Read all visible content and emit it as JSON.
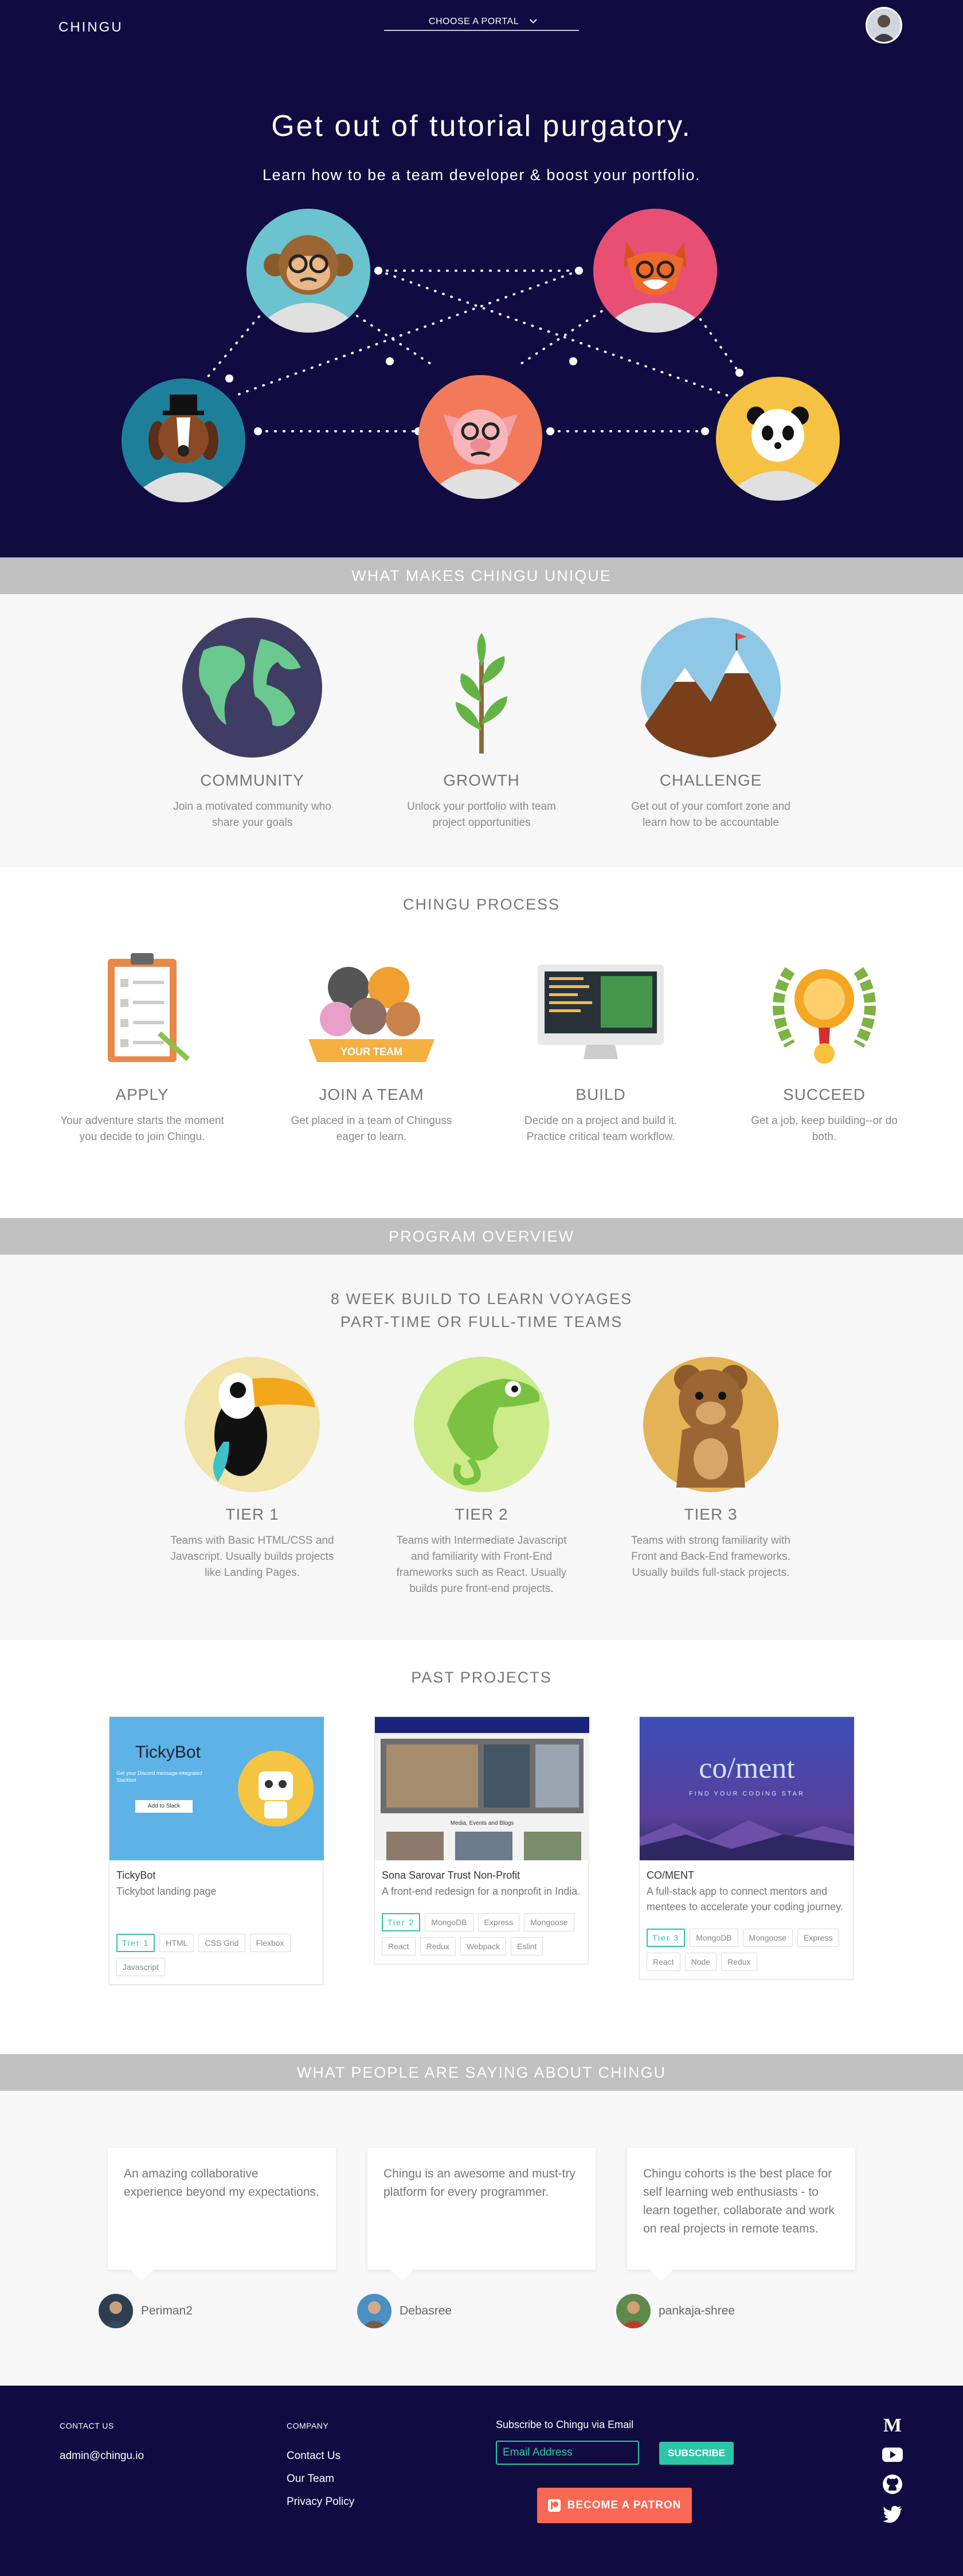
{
  "header": {
    "logo": "CHINGU",
    "portal_label": "CHOOSE A PORTAL",
    "avatar_icon": "user-avatar-icon"
  },
  "hero": {
    "title": "Get out of tutorial purgatory.",
    "subtitle": "Learn how to be a team developer & boost your portfolio.",
    "animals": [
      "monkey",
      "fox",
      "dog",
      "pig",
      "panda"
    ]
  },
  "unique": {
    "heading": "WHAT MAKES CHINGU UNIQUE",
    "items": [
      {
        "title": "COMMUNITY",
        "text": "Join a motivated community who share your goals",
        "icon": "globe-icon"
      },
      {
        "title": "GROWTH",
        "text": "Unlock your portfolio with team project opportunities",
        "icon": "sprout-icon"
      },
      {
        "title": "CHALLENGE",
        "text": "Get out of your comfort zone and learn how to be accountable",
        "icon": "mountain-icon"
      }
    ]
  },
  "process": {
    "heading": "CHINGU PROCESS",
    "items": [
      {
        "title": "APPLY",
        "text": "Your adventure starts the moment you decide to join Chingu.",
        "icon": "clipboard-icon"
      },
      {
        "title": "JOIN A TEAM",
        "text": "Get placed in a team of Chinguss eager to learn.",
        "icon": "team-icon",
        "badge": "YOUR TEAM"
      },
      {
        "title": "BUILD",
        "text": "Decide on a project and build it. Practice critical team workflow.",
        "icon": "monitor-icon"
      },
      {
        "title": "SUCCEED",
        "text": "Get a job, keep building--or do both.",
        "icon": "laurel-medal-icon"
      }
    ]
  },
  "program": {
    "heading": "PROGRAM OVERVIEW",
    "line1": "8 WEEK BUILD TO LEARN VOYAGES",
    "line2": "PART-TIME OR FULL-TIME TEAMS",
    "tiers": [
      {
        "title": "TIER 1",
        "text": "Teams with Basic HTML/CSS and Javascript. Usually builds projects like Landing Pages.",
        "icon": "toucan-icon"
      },
      {
        "title": "TIER 2",
        "text": "Teams with Intermediate Javascript and familiarity with Front-End frameworks such as React. Usually builds pure front-end projects.",
        "icon": "chameleon-icon"
      },
      {
        "title": "TIER 3",
        "text": "Teams with strong familiarity with Front and Back-End frameworks. Usually builds full-stack projects.",
        "icon": "bear-icon"
      }
    ]
  },
  "projects": {
    "heading": "PAST PROJECTS",
    "items": [
      {
        "name": "TickyBot",
        "desc": "Tickybot landing page",
        "tags": [
          "Tier 1",
          "HTML",
          "CSS Grid",
          "Flexbox",
          "Javascript"
        ],
        "shot": {
          "brand": "TickyBot",
          "tagline": "Get your Discord message-integrated Slackbot",
          "button": "Add to Slack"
        }
      },
      {
        "name": "Sona Sarovar Trust Non-Profit",
        "desc": "A front-end redesign for a nonprofit in India.",
        "tags": [
          "Tier 2",
          "MongoDB",
          "Express",
          "Mongoose",
          "React",
          "Redux",
          "Webpack",
          "Eslint"
        ],
        "shot": {
          "caption": "Media, Events and Blogs"
        }
      },
      {
        "name": "CO/MENT",
        "desc": "A full-stack app to connect mentors and mentees to accelerate your coding journey.",
        "tags": [
          "Tier 3",
          "MongoDB",
          "Mongoose",
          "Express",
          "React",
          "Node",
          "Redux"
        ],
        "shot": {
          "brand": "co/ment",
          "tagline": "FIND YOUR CODING STAR"
        }
      }
    ]
  },
  "testimonials": {
    "heading": "WHAT PEOPLE ARE SAYING ABOUT CHINGU",
    "items": [
      {
        "quote": "An amazing collaborative experience beyond my expectations.",
        "name": "Periman2"
      },
      {
        "quote": "Chingu is an awesome and must-try platform for every programmer.",
        "name": "Debasree"
      },
      {
        "quote": "Chingu cohorts is the best place for self learning web enthusiasts - to learn together, collaborate and work on real projects in remote teams.",
        "name": "pankaja-shree"
      }
    ]
  },
  "footer": {
    "contact_heading": "CONTACT US",
    "contact_email": "admin@chingu.io",
    "company_heading": "COMPANY",
    "company_links": [
      "Contact Us",
      "Our Team",
      "Privacy Policy"
    ],
    "subscribe_heading": "Subscribe to Chingu via Email",
    "email_placeholder": "Email Address",
    "subscribe_button": "SUBSCRIBE",
    "patron_button": "BECOME A PATRON",
    "social_icons": [
      "medium-icon",
      "youtube-icon",
      "github-icon",
      "twitter-icon"
    ]
  },
  "colors": {
    "navy": "#100c41",
    "teal": "#2cc5a8",
    "banner_grey": "#c0c0c0",
    "patreon": "#f96854"
  }
}
